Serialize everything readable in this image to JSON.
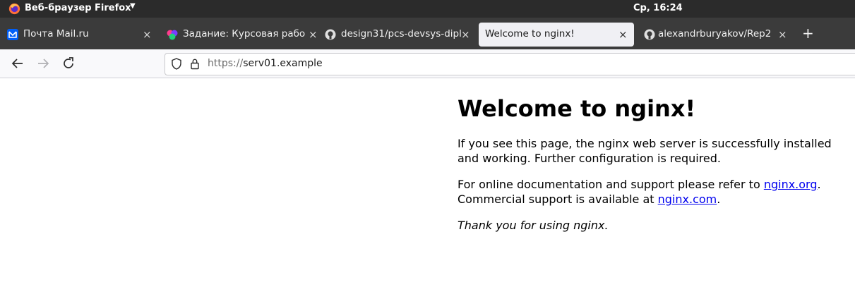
{
  "system_bar": {
    "app_menu": "Веб-браузер Firefox",
    "clock": "Ср, 16:24"
  },
  "tabs": [
    {
      "title": "Почта Mail.ru",
      "icon": "mail-icon",
      "active": false
    },
    {
      "title": "Задание: Курсовая рабо",
      "icon": "site-logo-icon",
      "active": false
    },
    {
      "title": "design31/pcs-devsys-dipl",
      "icon": "github-icon",
      "active": false
    },
    {
      "title": "Welcome to nginx!",
      "icon": "",
      "active": true
    },
    {
      "title": "alexandrburyakov/Rep2",
      "icon": "github-icon",
      "active": false
    }
  ],
  "tab_close_glyph": "×",
  "new_tab_glyph": "+",
  "address_bar": {
    "scheme": "https://",
    "host": "serv01.example"
  },
  "page": {
    "heading": "Welcome to nginx!",
    "para1": "If you see this page, the nginx web server is successfully installed and working. Further configuration is required.",
    "para2_prefix": "For online documentation and support please refer to ",
    "link1": "nginx.org",
    "para2_mid": ".",
    "para2_line2": "Commercial support is available at ",
    "link2": "nginx.com",
    "para2_end": ".",
    "para3": "Thank you for using nginx."
  },
  "colors": {
    "top_bar": "#2b2b2b",
    "tab_strip": "#3b3b3b",
    "active_tab": "#f0f0f4",
    "link": "#0000ee"
  }
}
